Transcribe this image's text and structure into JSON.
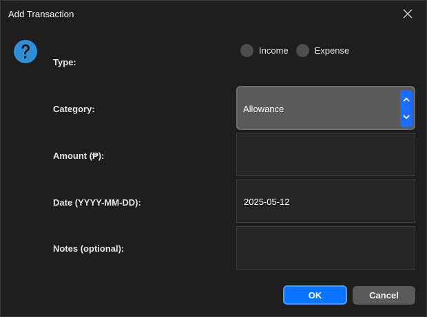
{
  "window": {
    "title": "Add Transaction"
  },
  "form": {
    "type": {
      "label": "Type:",
      "options": [
        {
          "label": "Income",
          "selected": false
        },
        {
          "label": "Expense",
          "selected": false
        }
      ]
    },
    "category": {
      "label": "Category:",
      "value": "Allowance"
    },
    "amount": {
      "label": "Amount (₱):",
      "value": ""
    },
    "date": {
      "label": "Date (YYYY-MM-DD):",
      "value": "2025-05-12"
    },
    "notes": {
      "label": "Notes (optional):",
      "value": ""
    }
  },
  "buttons": {
    "ok": "OK",
    "cancel": "Cancel"
  },
  "icons": {
    "help": "question-mark-icon",
    "close": "close-icon"
  },
  "colors": {
    "background": "#1e1e1e",
    "accent": "#0a74ff",
    "help_icon": "#2e8fd6",
    "field_bg": "#262626",
    "combo_bg": "#5a5a5a"
  }
}
